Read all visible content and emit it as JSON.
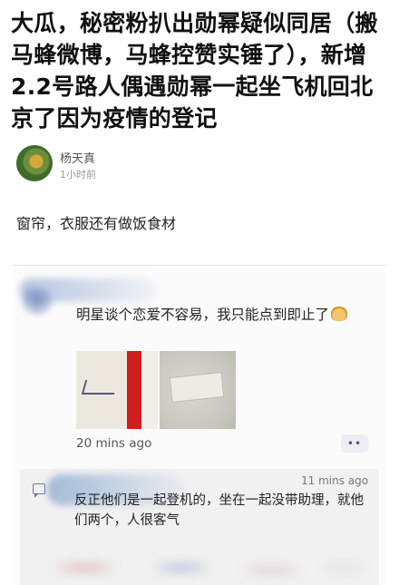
{
  "post": {
    "title": "大瓜，秘密粉扒出勋幂疑似同居（搬马蜂微博，马蜂控赞实锤了），新增2.2号路人偶遇勋幂一起坐飞机回北京了因为疫情的登记",
    "author": "杨天真",
    "time": "1小时前",
    "body": "窗帘，衣服还有做饭食材"
  },
  "comment": {
    "text": "明星谈个恋爱不容易，我只能点到即止了",
    "time": "20 mins ago",
    "more_label": "••"
  },
  "reply": {
    "time": "11 mins ago",
    "text": "反正他们是一起登机的，坐在一起没带助理，就他们两个，人很客气"
  },
  "colors": {
    "accent": "#4a5a85",
    "photo_red": "#d21d1d",
    "reply_bg": "#f1f1f1"
  }
}
